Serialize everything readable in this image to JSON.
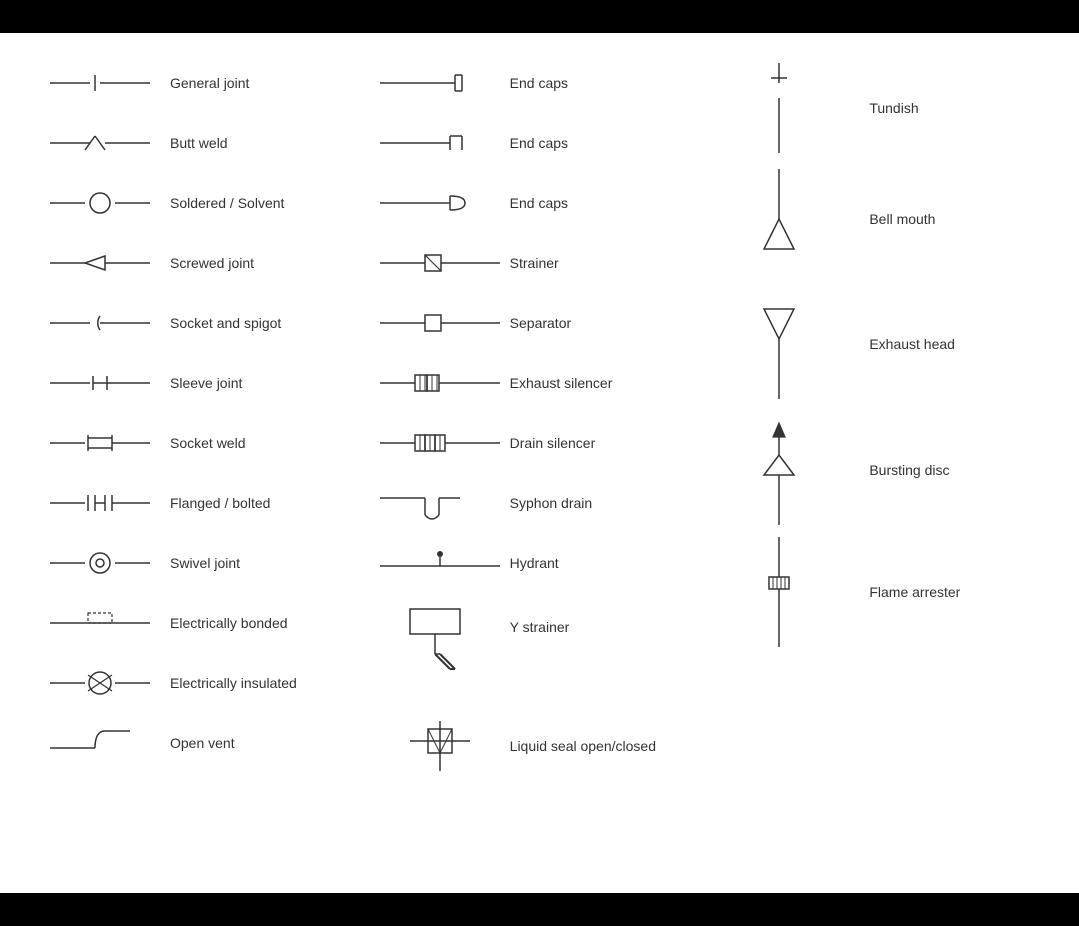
{
  "col1": [
    {
      "label": "General joint"
    },
    {
      "label": "Butt weld"
    },
    {
      "label": "Soldered / Solvent"
    },
    {
      "label": "Screwed joint"
    },
    {
      "label": "Socket and spigot"
    },
    {
      "label": "Sleeve joint"
    },
    {
      "label": "Socket weld"
    },
    {
      "label": "Flanged / bolted"
    },
    {
      "label": "Swivel joint"
    },
    {
      "label": "Electrically bonded"
    },
    {
      "label": "Electrically insulated"
    },
    {
      "label": "Open vent"
    }
  ],
  "col2": [
    {
      "label": "End caps"
    },
    {
      "label": "End caps"
    },
    {
      "label": "End caps"
    },
    {
      "label": "Strainer"
    },
    {
      "label": "Separator"
    },
    {
      "label": "Exhaust silencer"
    },
    {
      "label": "Drain silencer"
    },
    {
      "label": "Syphon drain"
    },
    {
      "label": "Hydrant"
    },
    {
      "label": "Y strainer"
    },
    {
      "label": ""
    },
    {
      "label": "Liquid seal open/closed"
    }
  ],
  "col3": [
    {
      "label": "Tundish"
    },
    {
      "label": ""
    },
    {
      "label": "Bell mouth"
    },
    {
      "label": ""
    },
    {
      "label": "Exhaust head"
    },
    {
      "label": ""
    },
    {
      "label": "Bursting disc"
    },
    {
      "label": ""
    },
    {
      "label": "Flame arrester"
    }
  ]
}
